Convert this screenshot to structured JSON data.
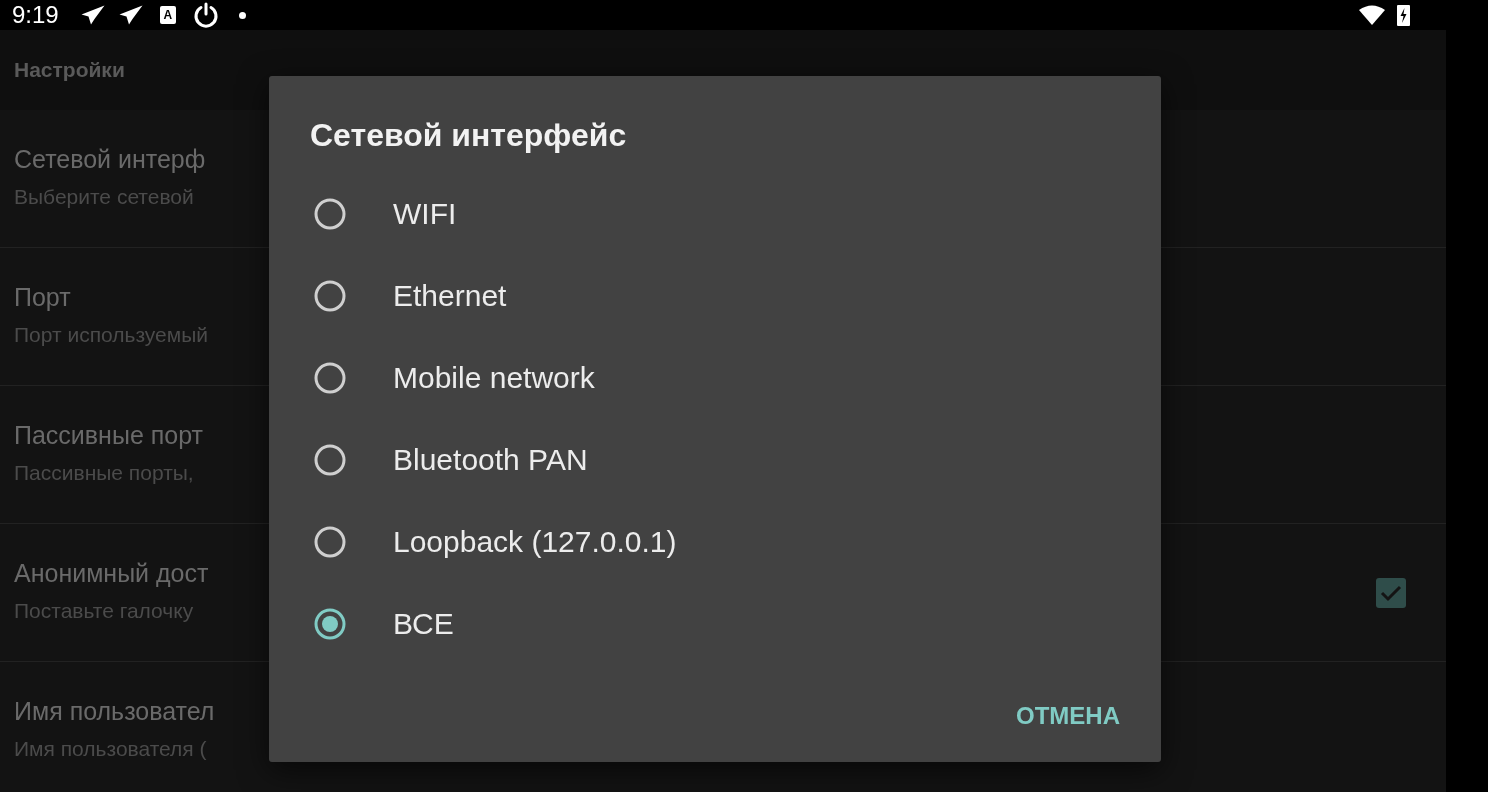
{
  "status_bar": {
    "time": "9:19",
    "letter_badge": "A"
  },
  "app_bar": {
    "title": "Настройки"
  },
  "settings": [
    {
      "kind": "text",
      "title": "Сетевой интерф",
      "summary": "Выберите сетевой"
    },
    {
      "kind": "text",
      "title": "Порт",
      "summary": "Порт используемый"
    },
    {
      "kind": "text",
      "title": "Пассивные порт",
      "summary": "Пассивные порты,"
    },
    {
      "kind": "checkbox",
      "title": "Анонимный дост",
      "summary": "Поставьте галочку",
      "checked": true
    },
    {
      "kind": "text",
      "title": "Имя пользовател",
      "summary": "Имя пользователя ("
    }
  ],
  "dialog": {
    "title": "Сетевой интерфейс",
    "options": [
      {
        "label": "WIFI",
        "selected": false
      },
      {
        "label": "Ethernet",
        "selected": false
      },
      {
        "label": "Mobile network",
        "selected": false
      },
      {
        "label": "Bluetooth PAN",
        "selected": false
      },
      {
        "label": "Loopback (127.0.0.1)",
        "selected": false
      },
      {
        "label": "ВСЕ",
        "selected": true
      }
    ],
    "buttons": [
      "ОТМЕНА"
    ]
  }
}
